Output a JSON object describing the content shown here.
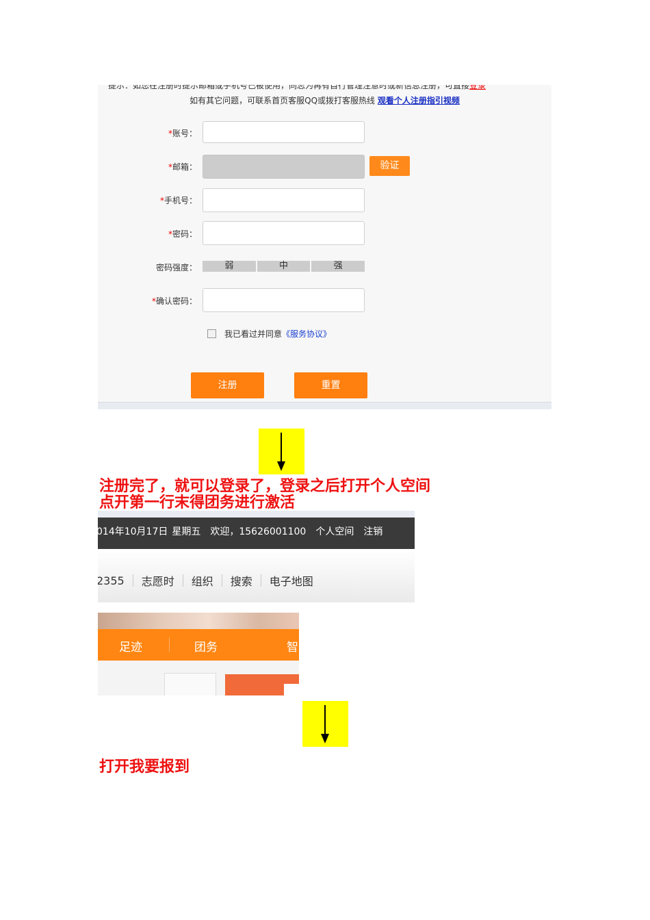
{
  "registration": {
    "notice_cut": "提示：如您在注册时提示邮箱或手机号已被使用，同志为再有自行管理注意时或新信息注册，可直接",
    "notice_cut_link": "登录",
    "notice": "如有其它问题，可联系首页客服QQ或拨打客服热线",
    "guide_link": "观看个人注册指引视频",
    "required_mark": "*",
    "fields": {
      "account": "账号：",
      "email": "邮箱：",
      "phone": "手机号：",
      "password": "密码：",
      "strength": "密码强度：",
      "confirm": "确认密码："
    },
    "verify_button": "验证",
    "strength_levels": [
      "弱",
      "中",
      "强"
    ],
    "agree_text": "我已看过并同意",
    "agreement_link": "《服务协议》",
    "register_button": "注册",
    "reset_button": "重置"
  },
  "captions": {
    "step1_line1": "注册完了，就可以登录了，登录之后打开个人空间",
    "step1_line2": "点开第一行末得团务进行激活",
    "step2": "打开我要报到"
  },
  "header_bar": {
    "date": "014年10月17日",
    "weekday": "星期五",
    "welcome": "欢迎，15626001100",
    "personal_space": "个人空间",
    "logout": "注销"
  },
  "header_nav": {
    "items": [
      "2355",
      "志愿时",
      "组织",
      "搜索",
      "电子地图"
    ]
  },
  "orange_nav": {
    "items": [
      "足迹",
      "团务",
      "智"
    ]
  },
  "colors": {
    "accent_orange": "#ff8612",
    "caption_red": "#e11111",
    "arrow_box_yellow": "#ffff00"
  }
}
